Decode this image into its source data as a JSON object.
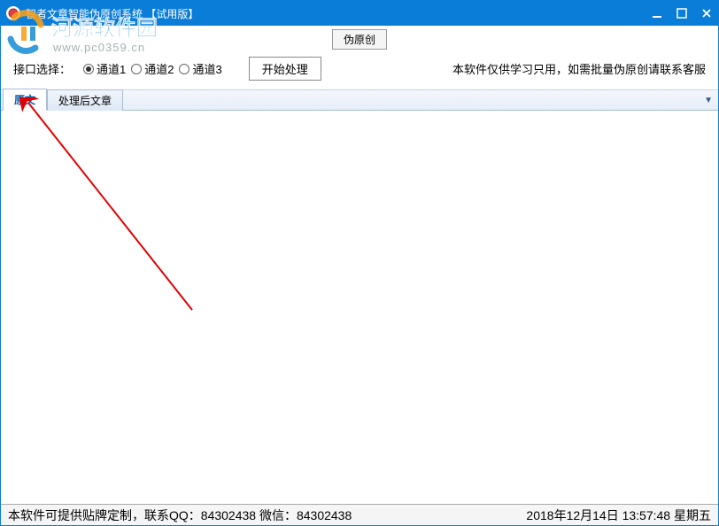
{
  "titlebar": {
    "title": "智者文章智能伪原创系统 【试用版】"
  },
  "topButton": {
    "label": "伪原创"
  },
  "controls": {
    "interfaceLabel": "接口选择：",
    "channels": [
      "通道1",
      "通道2",
      "通道3"
    ],
    "selectedChannel": 0,
    "processLabel": "开始处理",
    "note": "本软件仅供学习只用，如需批量伪原创请联系客服"
  },
  "tabs": {
    "items": [
      "原文",
      "处理后文章"
    ],
    "active": 0
  },
  "statusbar": {
    "left": "本软件可提供贴牌定制，联系QQ：84302438 微信：84302438",
    "right": "2018年12月14日 13:57:48 星期五"
  },
  "watermark": {
    "text": "河源软件园",
    "url": "www.pc0359.cn"
  }
}
